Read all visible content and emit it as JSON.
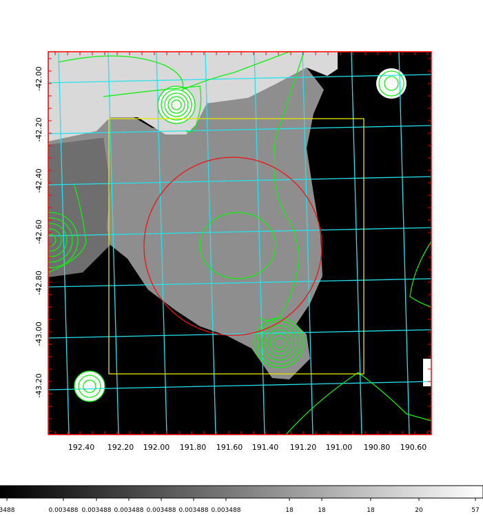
{
  "map": {
    "ra_ticks": [
      "192.40",
      "192.20",
      "192.00",
      "191.80",
      "191.60",
      "191.40",
      "191.20",
      "191.00",
      "190.80",
      "190.60"
    ],
    "dec_ticks": [
      "-42.00",
      "-42.20",
      "-42.40",
      "-42.60",
      "-42.80",
      "-43.00",
      "-43.20"
    ],
    "colors": {
      "frame": "#ff0000",
      "grid": "#22e3ee",
      "contour": "#11ee11",
      "box": "#e8e800",
      "circle": "#ee1111",
      "background": "#000000"
    },
    "icons": [
      "yellow-rectangle-region",
      "red-circle-region",
      "green-contours",
      "cyan-coordinate-grid"
    ]
  },
  "colorbar": {
    "labels": [
      "3488",
      "0.003488",
      "0.003488",
      "0.003488",
      "0.003488",
      "0.003488",
      "0.003488",
      "18",
      "18",
      "18",
      "20",
      "57"
    ]
  }
}
